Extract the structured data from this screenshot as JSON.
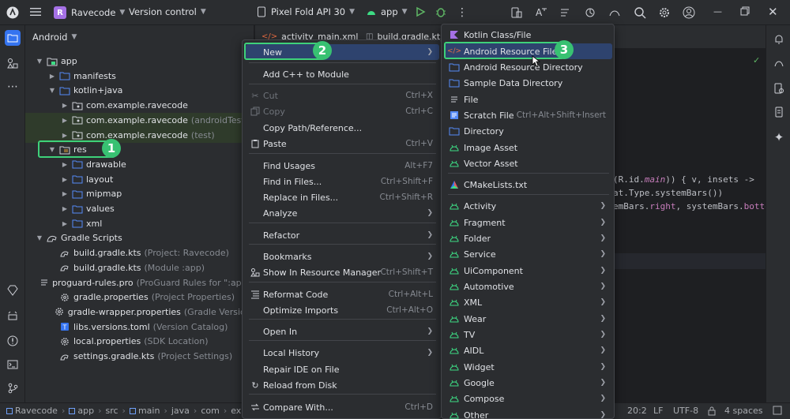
{
  "titlebar": {
    "project_badge": "R",
    "project_name": "Ravecode",
    "vcs": "Version control",
    "device": "Pixel Fold API 30",
    "run_config": "app"
  },
  "project_panel": {
    "title": "Android",
    "tree": [
      {
        "label": "app",
        "hint": "",
        "icon": "module-icon",
        "depth": 1,
        "expanded": true
      },
      {
        "label": "manifests",
        "hint": "",
        "icon": "folder-icon",
        "depth": 2,
        "expanded": false
      },
      {
        "label": "kotlin+java",
        "hint": "",
        "icon": "folder-icon",
        "depth": 2,
        "expanded": true
      },
      {
        "label": "com.example.ravecode",
        "hint": "",
        "icon": "package-icon",
        "depth": 3,
        "expanded": false
      },
      {
        "label": "com.example.ravecode",
        "hint": "(androidTest)",
        "icon": "package-icon",
        "depth": 3,
        "expanded": false
      },
      {
        "label": "com.example.ravecode",
        "hint": "(test)",
        "icon": "package-icon",
        "depth": 3,
        "expanded": false
      },
      {
        "label": "res",
        "hint": "",
        "icon": "res-folder-icon",
        "depth": 2,
        "expanded": true
      },
      {
        "label": "drawable",
        "hint": "",
        "icon": "folder-icon",
        "depth": 3,
        "expanded": false
      },
      {
        "label": "layout",
        "hint": "",
        "icon": "folder-icon",
        "depth": 3,
        "expanded": false
      },
      {
        "label": "mipmap",
        "hint": "",
        "icon": "folder-icon",
        "depth": 3,
        "expanded": false
      },
      {
        "label": "values",
        "hint": "",
        "icon": "folder-icon",
        "depth": 3,
        "expanded": false
      },
      {
        "label": "xml",
        "hint": "",
        "icon": "folder-icon",
        "depth": 3,
        "expanded": false
      },
      {
        "label": "Gradle Scripts",
        "hint": "",
        "icon": "gradle-icon",
        "depth": 1,
        "expanded": true
      },
      {
        "label": "build.gradle.kts",
        "hint": "(Project: Ravecode)",
        "icon": "gradle-file-icon",
        "depth": 2
      },
      {
        "label": "build.gradle.kts",
        "hint": "(Module :app)",
        "icon": "gradle-file-icon",
        "depth": 2
      },
      {
        "label": "proguard-rules.pro",
        "hint": "(ProGuard Rules for \":app\")",
        "icon": "text-file-icon",
        "depth": 2
      },
      {
        "label": "gradle.properties",
        "hint": "(Project Properties)",
        "icon": "settings-file-icon",
        "depth": 2
      },
      {
        "label": "gradle-wrapper.properties",
        "hint": "(Gradle Version)",
        "icon": "settings-file-icon",
        "depth": 2
      },
      {
        "label": "libs.versions.toml",
        "hint": "(Version Catalog)",
        "icon": "toml-file-icon",
        "depth": 2
      },
      {
        "label": "local.properties",
        "hint": "(SDK Location)",
        "icon": "settings-file-icon",
        "depth": 2
      },
      {
        "label": "settings.gradle.kts",
        "hint": "(Project Settings)",
        "icon": "gradle-file-icon",
        "depth": 2
      }
    ]
  },
  "editor": {
    "tabs": [
      "activity_main.xml",
      "build.gradle.kts"
    ],
    "code_lines": [
      "(R.id.main)) { v, insets ->",
      "at.Type.systemBars())",
      "emBars.right, systemBars.bottom"
    ],
    "code_italic": "main"
  },
  "context_menu": {
    "items": [
      {
        "label": "New",
        "shortcut": "",
        "submenu": true,
        "selected": true
      },
      {
        "label": "Add C++ to Module",
        "shortcut": ""
      },
      {
        "label": "Cut",
        "shortcut": "Ctrl+X",
        "disabled": true,
        "icon": "cut-icon"
      },
      {
        "label": "Copy",
        "shortcut": "Ctrl+C",
        "disabled": true,
        "icon": "copy-icon"
      },
      {
        "label": "Copy Path/Reference...",
        "shortcut": ""
      },
      {
        "label": "Paste",
        "shortcut": "Ctrl+V",
        "icon": "paste-icon"
      },
      {
        "label": "Find Usages",
        "shortcut": "Alt+F7"
      },
      {
        "label": "Find in Files...",
        "shortcut": "Ctrl+Shift+F"
      },
      {
        "label": "Replace in Files...",
        "shortcut": "Ctrl+Shift+R"
      },
      {
        "label": "Analyze",
        "shortcut": "",
        "submenu": true
      },
      {
        "label": "Refactor",
        "shortcut": "",
        "submenu": true
      },
      {
        "label": "Bookmarks",
        "shortcut": "",
        "submenu": true
      },
      {
        "label": "Show In Resource Manager",
        "shortcut": "Ctrl+Shift+T",
        "icon": "resource-manager-icon"
      },
      {
        "label": "Reformat Code",
        "shortcut": "Ctrl+Alt+L",
        "icon": "reformat-icon"
      },
      {
        "label": "Optimize Imports",
        "shortcut": "Ctrl+Alt+O"
      },
      {
        "label": "Open In",
        "shortcut": "",
        "submenu": true
      },
      {
        "label": "Local History",
        "shortcut": "",
        "submenu": true
      },
      {
        "label": "Repair IDE on File",
        "shortcut": ""
      },
      {
        "label": "Reload from Disk",
        "shortcut": "",
        "icon": "reload-icon"
      },
      {
        "label": "Compare With...",
        "shortcut": "Ctrl+D",
        "icon": "compare-icon"
      }
    ]
  },
  "new_submenu": {
    "items": [
      {
        "label": "Kotlin Class/File",
        "shortcut": "",
        "icon": "kotlin-icon"
      },
      {
        "label": "Android Resource File",
        "shortcut": "",
        "icon": "xml-resource-icon",
        "selected": true
      },
      {
        "label": "Android Resource Directory",
        "shortcut": "",
        "icon": "folder-icon"
      },
      {
        "label": "Sample Data Directory",
        "shortcut": "",
        "icon": "folder-icon"
      },
      {
        "label": "File",
        "shortcut": "",
        "icon": "file-icon"
      },
      {
        "label": "Scratch File",
        "shortcut": "Ctrl+Alt+Shift+Insert",
        "icon": "scratch-file-icon"
      },
      {
        "label": "Directory",
        "shortcut": "",
        "icon": "folder-icon"
      },
      {
        "label": "Image Asset",
        "shortcut": "",
        "icon": "android-icon"
      },
      {
        "label": "Vector Asset",
        "shortcut": "",
        "icon": "android-icon"
      },
      {
        "label": "CMakeLists.txt",
        "shortcut": "",
        "icon": "cmake-icon"
      },
      {
        "label": "Activity",
        "submenu": true,
        "icon": "android-icon"
      },
      {
        "label": "Fragment",
        "submenu": true,
        "icon": "android-icon"
      },
      {
        "label": "Folder",
        "submenu": true,
        "icon": "android-icon"
      },
      {
        "label": "Service",
        "submenu": true,
        "icon": "android-icon"
      },
      {
        "label": "UiComponent",
        "submenu": true,
        "icon": "android-icon"
      },
      {
        "label": "Automotive",
        "submenu": true,
        "icon": "android-icon"
      },
      {
        "label": "XML",
        "submenu": true,
        "icon": "android-icon"
      },
      {
        "label": "Wear",
        "submenu": true,
        "icon": "android-icon"
      },
      {
        "label": "TV",
        "submenu": true,
        "icon": "android-icon"
      },
      {
        "label": "AIDL",
        "submenu": true,
        "icon": "android-icon"
      },
      {
        "label": "Widget",
        "submenu": true,
        "icon": "android-icon"
      },
      {
        "label": "Google",
        "submenu": true,
        "icon": "android-icon"
      },
      {
        "label": "Compose",
        "submenu": true,
        "icon": "android-icon"
      },
      {
        "label": "Other",
        "submenu": true,
        "icon": "android-icon"
      }
    ]
  },
  "callouts": [
    "1",
    "2",
    "3"
  ],
  "statusbar": {
    "breadcrumb": [
      "Ravecode",
      "app",
      "src",
      "main",
      "java",
      "com",
      "ex"
    ],
    "position": "20:2",
    "line_ending": "LF",
    "encoding": "UTF-8",
    "indent": "4 spaces"
  },
  "colors": {
    "accent": "#3574f0",
    "selection": "#2e436e",
    "callout": "#38c172",
    "android_green": "#3ddc84"
  }
}
